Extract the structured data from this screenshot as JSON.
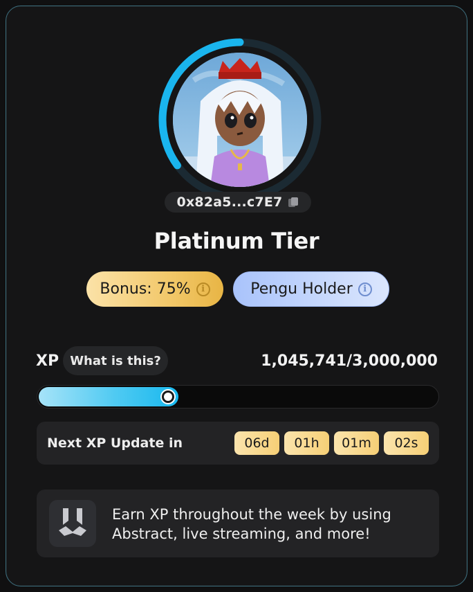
{
  "profile": {
    "address": "0x82a5...c7E7",
    "tier": "Platinum Tier",
    "tier_progress": 0.35
  },
  "badges": {
    "bonus_label": "Bonus: 75%",
    "holder_label": "Pengu Holder",
    "info_glyph": "i"
  },
  "xp": {
    "label": "XP",
    "help_button": "What is this?",
    "value_text": "1,045,741/3,000,000",
    "current": 1045741,
    "max": 3000000,
    "bar_fraction": 0.35
  },
  "update": {
    "label": "Next XP Update in",
    "days": "06d",
    "hours": "01h",
    "minutes": "01m",
    "seconds": "02s"
  },
  "promo": {
    "text": "Earn XP throughout the week by using Abstract, live streaming, and more!"
  },
  "icons": {
    "copy": "copy-icon",
    "info": "info-icon",
    "logo": "abstract-logo-icon"
  },
  "colors": {
    "ring_accent": "#1ab5ee",
    "card_border": "#3c6f7f",
    "bonus_gold": "#f2c86a",
    "pengu_blue": "#a9c3fb"
  }
}
